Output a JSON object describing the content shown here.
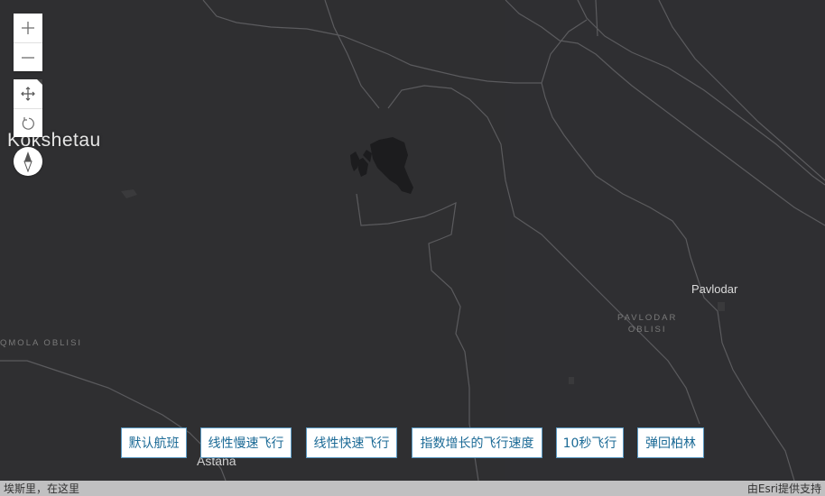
{
  "map": {
    "labels": {
      "kokshetau": "Kokshetau",
      "pavlodar": "Pavlodar",
      "pavlodar_oblisi_line1": "PAVLODAR",
      "pavlodar_oblisi_line2": "OBLISI",
      "aqmola_oblisi": "QMOLA OBLISI",
      "astana": "Astana"
    }
  },
  "controls": {
    "zoom_in_icon": "plus-icon",
    "zoom_out_icon": "minus-icon",
    "pan_icon": "move-arrows-icon",
    "rotate_icon": "rotate-icon",
    "compass_icon": "compass-icon"
  },
  "buttons": {
    "default_flight": "默认航班",
    "linear_slow": "线性慢速飞行",
    "linear_fast": "线性快速飞行",
    "exponential": "指数增长的飞行速度",
    "ten_seconds": "10秒飞行",
    "back_berlin": "弹回柏林"
  },
  "attribution": {
    "left": "埃斯里，在这里",
    "right": "由Esri提供支持"
  },
  "colors": {
    "map_background": "#2f2f31",
    "border_line": "#5b5b5e",
    "lake": "#1c1c1e",
    "button_text": "#1b6a96",
    "button_border": "#5a9ac4"
  }
}
